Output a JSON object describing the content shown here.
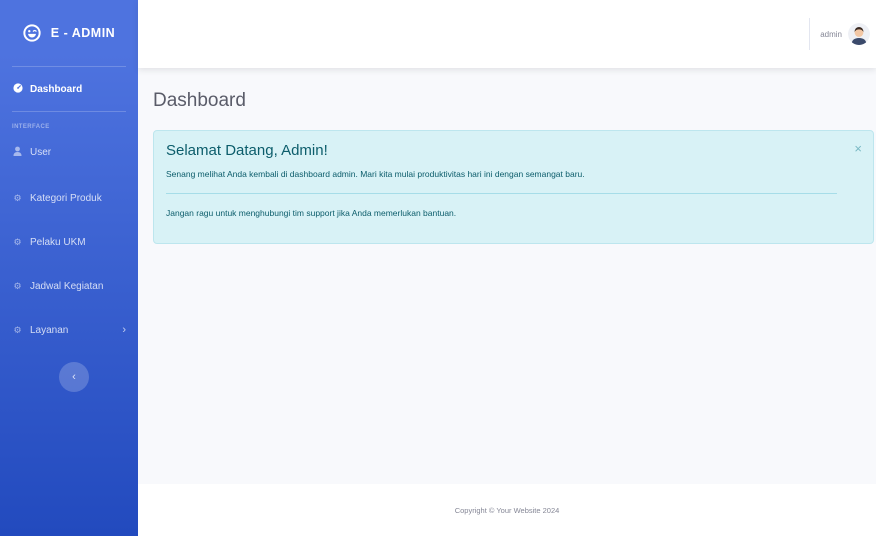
{
  "brand": {
    "name": "E - ADMIN",
    "icon": "laugh-wink-icon"
  },
  "sidebar": {
    "dashboard": {
      "label": "Dashboard",
      "icon": "tachometer-icon"
    },
    "heading": "INTERFACE",
    "items": [
      {
        "label": "User",
        "icon": "user-icon"
      },
      {
        "label": "Kategori Produk",
        "icon": "cog-icon"
      },
      {
        "label": "Pelaku UKM",
        "icon": "cog-icon"
      },
      {
        "label": "Jadwal Kegiatan",
        "icon": "cog-icon"
      },
      {
        "label": "Layanan",
        "icon": "cog-icon",
        "has_chevron": true
      }
    ],
    "toggle_symbol": "‹"
  },
  "topbar": {
    "user_name": "admin",
    "avatar_icon": "user-avatar-icon"
  },
  "main": {
    "page_title": "Dashboard",
    "alert": {
      "heading": "Selamat Datang, Admin!",
      "line1": "Senang melihat Anda kembali di dashboard admin. Mari kita mulai produktivitas hari ini dengan semangat baru.",
      "line2": "Jangan ragu untuk menghubungi tim support jika Anda memerlukan bantuan.",
      "close_symbol": "×"
    }
  },
  "footer": {
    "text": "Copyright © Your Website 2024"
  },
  "colors": {
    "sidebar_top": "#4e73df",
    "sidebar_bottom": "#224abe",
    "alert_bg": "#d8f2f6",
    "alert_text": "#0c5d6b"
  }
}
